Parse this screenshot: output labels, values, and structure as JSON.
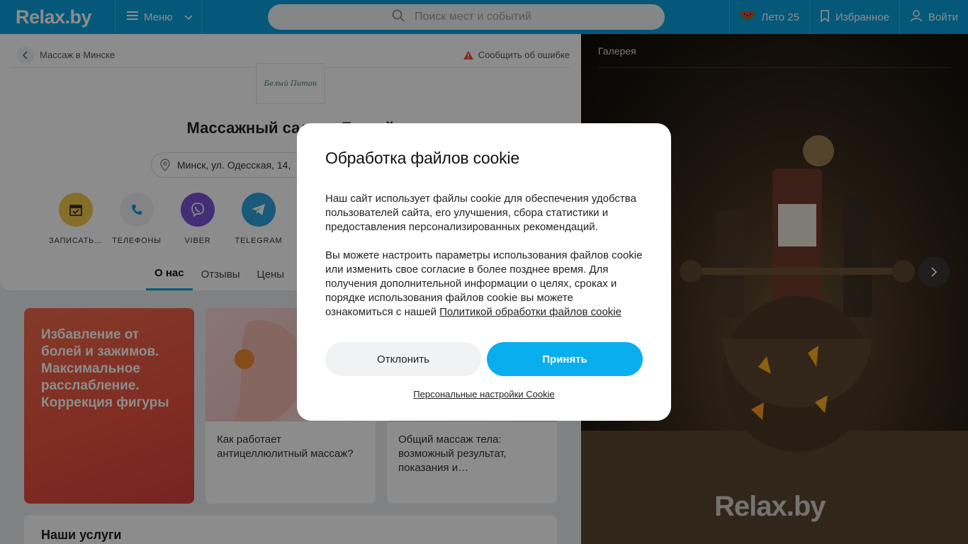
{
  "header": {
    "logo": "Relax.by",
    "menu_label": "Меню",
    "search_placeholder": "Поиск мест и событий",
    "summer_label": "Лето 25",
    "favorites_label": "Избранное",
    "login_label": "Войти"
  },
  "page": {
    "breadcrumb": "Массаж в Минске",
    "report_label": "Сообщить об ошибке",
    "salon_logo_text": "Белый Питон",
    "title": "Массажный салон «Белый",
    "address": "Минск, ул. Одесская, 14,",
    "actions": [
      {
        "label": "ЗАПИСАТЬ…",
        "icon": "calendar-icon",
        "color": "#f2c94c"
      },
      {
        "label": "ТЕЛЕФОНЫ",
        "icon": "phone-icon",
        "color": "#eef0f2"
      },
      {
        "label": "VIBER",
        "icon": "viber-icon",
        "color": "#7b55d6"
      },
      {
        "label": "TELEGRAM",
        "icon": "telegram-icon",
        "color": "#2ea3dd"
      }
    ],
    "tabs": [
      "О нас",
      "Отзывы",
      "Цены"
    ],
    "promo_text": "Избавление от болей и зажимов. Максимальное расслабление. Коррекция фигуры",
    "articles": [
      {
        "title": "Как работает антицеллюлитный массаж?"
      },
      {
        "title": "Общий массаж тела: возможный результат, показания и…"
      }
    ],
    "services_title": "Наши услуги"
  },
  "gallery": {
    "title": "Галерея",
    "watermark": "Relax.by"
  },
  "cookie_modal": {
    "title": "Обработка файлов cookie",
    "paragraph1": "Наш сайт использует файлы cookie для обеспечения удобства пользователей сайта, его улучшения, сбора статистики и предоставления персонализированных рекомендаций.",
    "paragraph2_text": "Вы можете настроить параметры использования файлов cookie или изменить свое согласие в более позднее время. Для получения дополнительной информации о целях, сроках и порядке использования файлов cookie вы можете ознакомиться с нашей ",
    "policy_link": "Политикой обработки файлов cookie",
    "decline_label": "Отклонить",
    "accept_label": "Принять",
    "personal_settings_label": "Персональные настройки Cookie"
  }
}
